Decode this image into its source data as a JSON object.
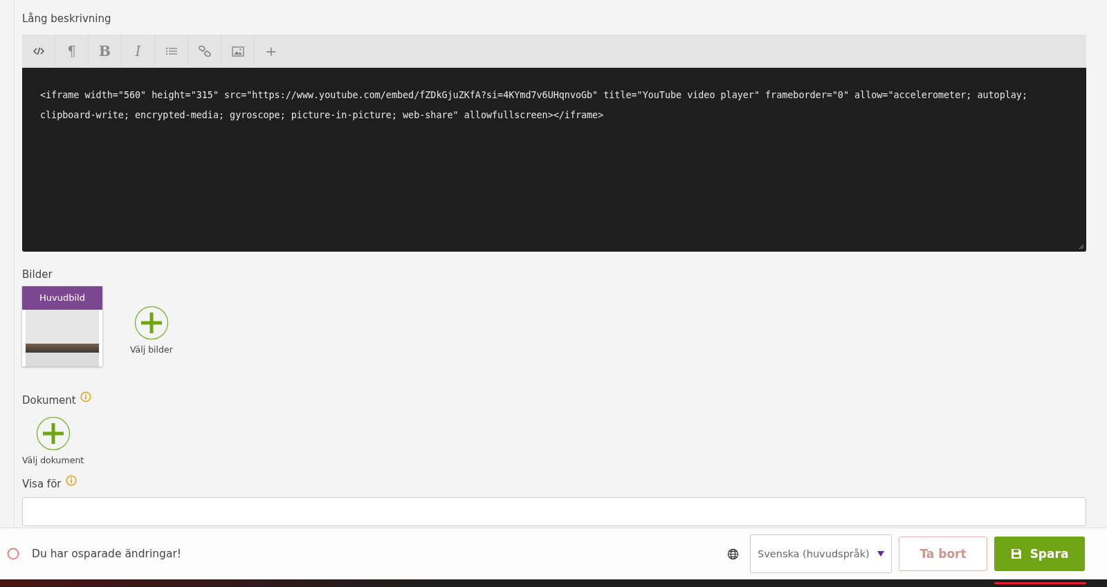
{
  "description": {
    "label": "Lång beskrivning",
    "toolbar": [
      {
        "kind": "code",
        "selected": true
      },
      {
        "kind": "glyph",
        "glyph": "¶",
        "selected": false
      },
      {
        "kind": "glyph",
        "glyph": "B",
        "selected": false
      },
      {
        "kind": "glyph",
        "glyph": "I",
        "selected": false
      },
      {
        "kind": "list",
        "selected": false
      },
      {
        "kind": "link",
        "selected": false
      },
      {
        "kind": "image",
        "selected": false
      },
      {
        "kind": "glyph",
        "glyph": "+",
        "selected": false
      }
    ],
    "code": "<iframe width=\"560\" height=\"315\" src=\"https://www.youtube.com/embed/fZDkGjuZKfA?si=4KYmd7v6UHqnvoGb\" title=\"YouTube video player\" frameborder=\"0\" allow=\"accelerometer; autoplay; clipboard-write; encrypted-media; gyroscope; picture-in-picture; web-share\" allowfullscreen></iframe>"
  },
  "images": {
    "label": "Bilder",
    "main_badge": "Huvudbild",
    "add_label": "Välj bilder"
  },
  "documents": {
    "label": "Dokument",
    "add_label": "Välj dokument"
  },
  "visibility": {
    "label": "Visa för"
  },
  "footer": {
    "message": "Du har osparade ändringar!",
    "language": "Svenska (huvudspråk)",
    "delete_button": "Ta bort",
    "save_button": "Spara"
  }
}
